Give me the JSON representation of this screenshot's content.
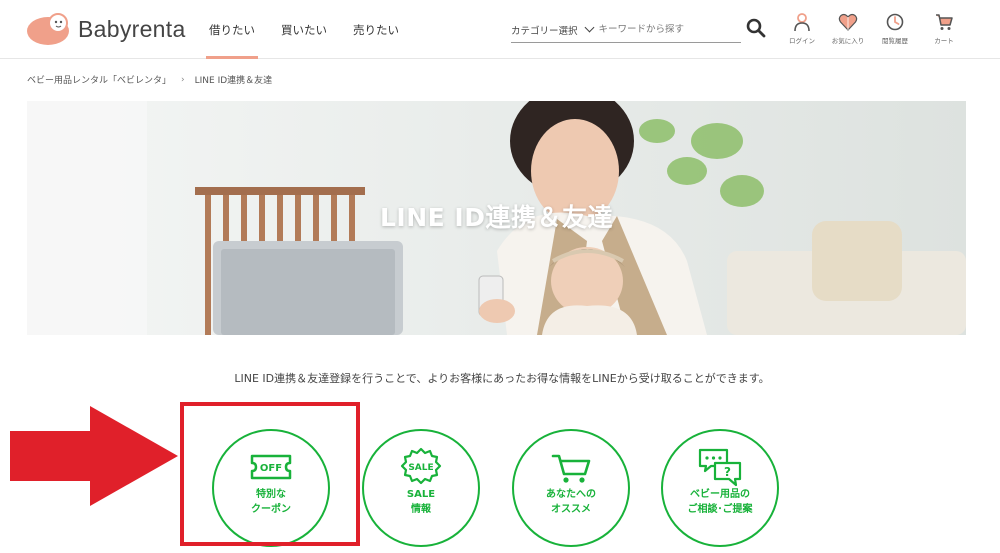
{
  "header": {
    "logo_text": "Babyrenta",
    "nav": [
      {
        "label": "借りたい",
        "active": true
      },
      {
        "label": "買いたい",
        "active": false
      },
      {
        "label": "売りたい",
        "active": false
      }
    ],
    "search": {
      "category_label": "カテゴリー選択",
      "placeholder": "キーワードから探す"
    },
    "icons": [
      {
        "label": "ログイン",
        "icon": "user-icon"
      },
      {
        "label": "お気に入り",
        "icon": "heart-icon"
      },
      {
        "label": "閲覧履歴",
        "icon": "history-icon"
      },
      {
        "label": "カート",
        "icon": "cart-icon"
      }
    ]
  },
  "breadcrumb": {
    "home": "ベビー用品レンタル「べビレンタ」",
    "separator": "›",
    "current": "LINE ID連携＆友達"
  },
  "hero": {
    "title": "LINE ID連携＆友達"
  },
  "description": "LINE ID連携＆友達登録を行うことで、よりお客様にあったお得な情報をLINEから受け取ることができます。",
  "features": [
    {
      "line1": "特別な",
      "line2": "クーポン",
      "icon": "coupon-icon",
      "icon_text": "OFF"
    },
    {
      "line1": "SALE",
      "line2": "情報",
      "icon": "sale-badge-icon",
      "icon_text": "SALE"
    },
    {
      "line1": "あなたへの",
      "line2": "オススメ",
      "icon": "cart-icon"
    },
    {
      "line1": "ベビー用品の",
      "line2": "ご相談･ご提案",
      "icon": "chat-bubbles-icon",
      "icon_text": "?"
    }
  ],
  "colors": {
    "accent": "#f0a08a",
    "line_green": "#18b23a",
    "annotation_red": "#e0202a"
  }
}
